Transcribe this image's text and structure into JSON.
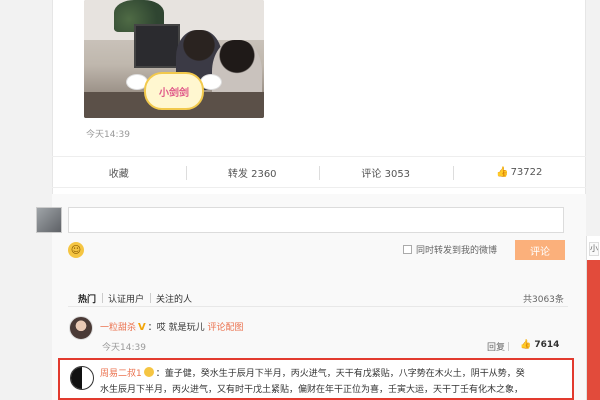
{
  "post": {
    "sticker_text": "小剑剑",
    "time": "今天14:39"
  },
  "actions": {
    "favorite": "收藏",
    "repost": "转发 2360",
    "comment": "评论 3053",
    "like": "73722"
  },
  "composer": {
    "input_value": "",
    "repost_label": "同时转发到我的微博",
    "submit_label": "评论"
  },
  "side_strip_tab": "小",
  "filters": {
    "tabs": [
      "热门",
      "认证用户",
      "关注的人"
    ],
    "total": "共3063条"
  },
  "comments": [
    {
      "name": "一粒甜杀",
      "badge": "V",
      "text": "：哎 就是玩儿",
      "pic_link": "评论配图",
      "time": "今天14:39",
      "reply": "回复",
      "likes": "7614"
    },
    {
      "name": "周易二叔1",
      "text_line1": "：董子健，癸水生于辰月下半月，丙火进气，天干有戊紧贴，八字势在木火土，阴干从势，癸",
      "text_line2": "水生辰月下半月，丙火进气，又有时干戊土紧贴，偏财在年干正位为喜，壬寅大运，天干丁壬有化木之象，"
    }
  ],
  "colors": {
    "accent": "#eb7350",
    "highlight": "#e23a2e",
    "submit_bg": "#fbb07b"
  },
  "icons": {
    "like": "thumbs-up-icon",
    "emoji": "smiley-icon",
    "yin_yang": "yin-yang-avatar"
  }
}
